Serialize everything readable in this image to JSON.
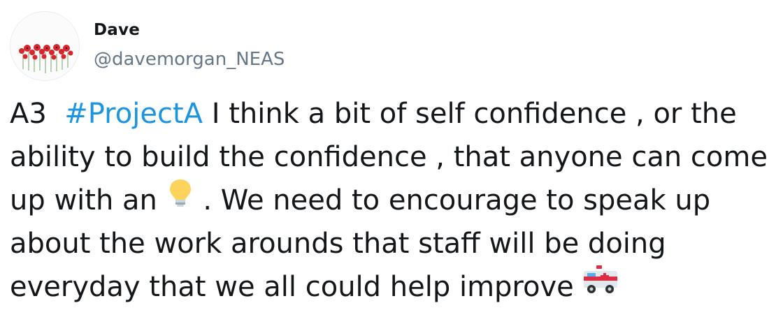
{
  "author": {
    "name": "Dave",
    "handle": "@davemorgan_NEAS",
    "avatar_caption": "Lest we forget ..."
  },
  "tweet": {
    "lines": [
      {
        "before": "A3  ",
        "hashtag": "#ProjectA",
        "after": " I think a bit of self confidence , or the"
      },
      {
        "text": "ability to build the confidence , that anyone can come"
      },
      {
        "before": "up with an ",
        "emoji": "light-bulb-icon",
        "after": " . We need to encourage to speak up"
      },
      {
        "text": "about the work arounds that staff will be doing"
      },
      {
        "before": "everyday that we all could help improve ",
        "emoji": "ambulance-icon"
      }
    ]
  },
  "colors": {
    "link": "#1b95e0",
    "text": "#14171a",
    "muted": "#657786"
  }
}
